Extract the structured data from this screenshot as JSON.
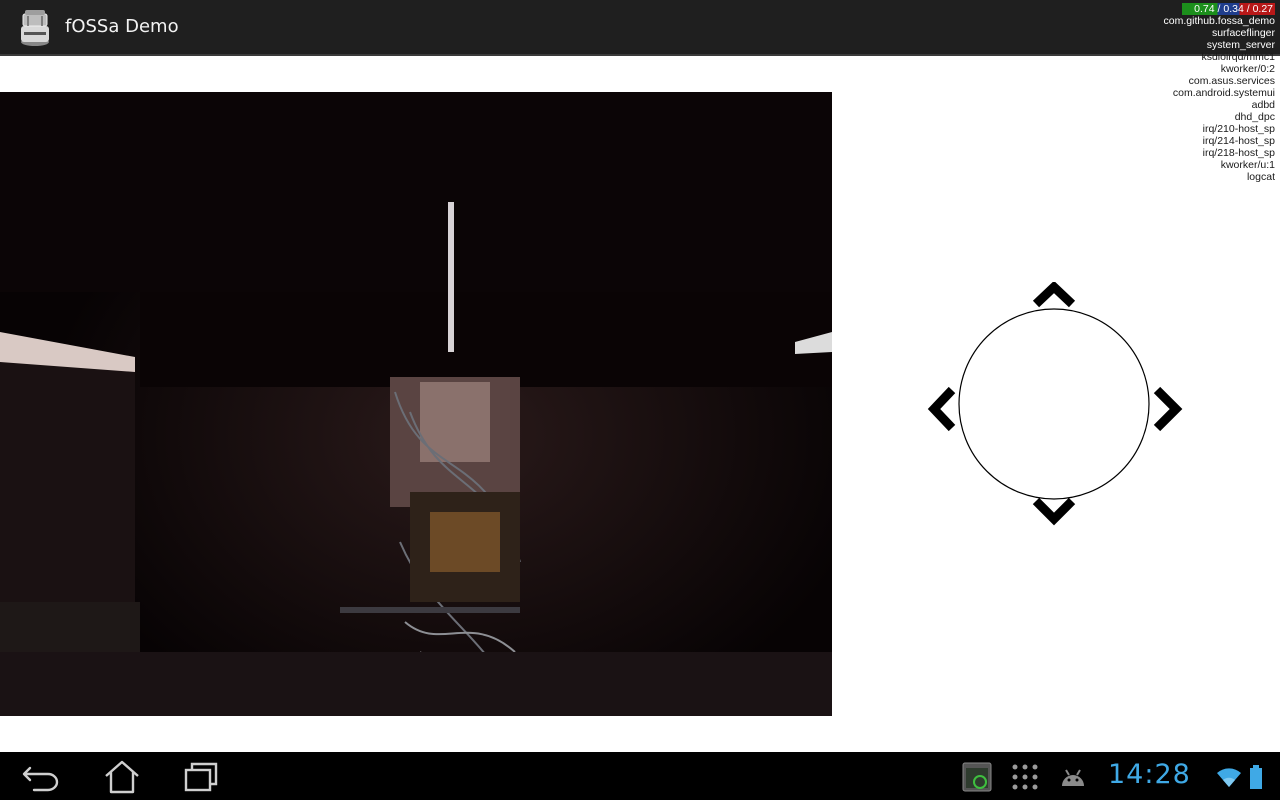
{
  "app": {
    "title": "fOSSa Demo",
    "icon": "robot-icon"
  },
  "cpu_overlay": {
    "load_1": "0.74",
    "load_5": "0.34",
    "load_15": "0.27",
    "separator": " / ",
    "processes": [
      "com.github.fossa_demo",
      "surfaceflinger",
      "system_server",
      "ksdioirqd/mmc1",
      "kworker/0:2",
      "com.asus.services",
      "com.android.systemui",
      "adbd",
      "dhd_dpc",
      "irq/210-host_sp",
      "irq/214-host_sp",
      "irq/218-host_sp",
      "kworker/u:1",
      "logcat"
    ]
  },
  "camera": {
    "name": "camera-feed"
  },
  "dpad": {
    "buttons": [
      "up-arrow-icon",
      "left-arrow-icon",
      "right-arrow-icon",
      "down-arrow-icon"
    ]
  },
  "nav_bar": {
    "buttons": [
      "back-icon",
      "home-icon",
      "recent-apps-icon"
    ],
    "tray_icons": [
      "screenshot-app-icon",
      "app-drawer-icon",
      "android-debug-icon",
      "wifi-icon",
      "battery-icon"
    ],
    "clock": "14:28",
    "clock_color": "#3fa9e6"
  }
}
